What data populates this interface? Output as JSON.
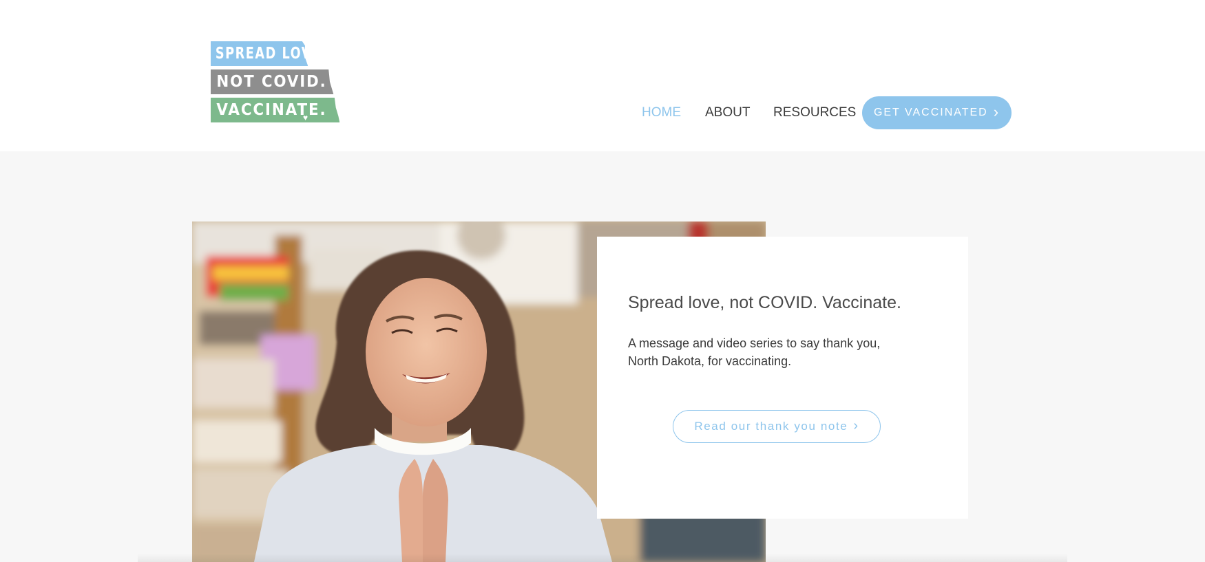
{
  "header": {
    "logo": {
      "line1": "SPREAD LOVE,",
      "line2": "NOT COVID.",
      "line3": "VACCINATE.",
      "heart_icon": "heart-icon",
      "colors": {
        "line1": "#8ec5ec",
        "line2": "#8e8e8e",
        "line3": "#7db98c"
      }
    },
    "nav": {
      "items": [
        {
          "label": "HOME",
          "active": true
        },
        {
          "label": "ABOUT",
          "active": false
        },
        {
          "label": "RESOURCES",
          "active": false
        }
      ],
      "cta_label": "GET VACCINATED",
      "cta_icon": "chevron-right-icon"
    }
  },
  "hero": {
    "photo_alt_icon": "photo-of-smiling-woman",
    "card": {
      "title": "Spread love, not COVID. Vaccinate.",
      "text": "A message and video series to say thank you, North Dakota, for vaccinating.",
      "button_label": "Read our thank you note",
      "button_icon": "chevron-right-icon"
    }
  },
  "colors": {
    "accent": "#8ec5ec",
    "page_bg": "#f7f7f7",
    "header_bg": "#ffffff",
    "text": "#3a3a3a"
  }
}
